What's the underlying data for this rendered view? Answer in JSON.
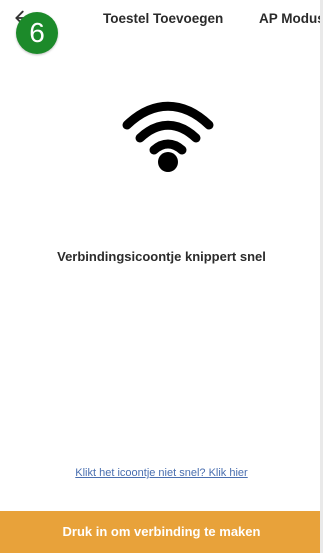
{
  "header": {
    "step_number": "6",
    "title": "Toestel Toevoegen",
    "mode_tab": "AP Modus"
  },
  "main": {
    "status_text": "Verbindingsicoontje knippert snel",
    "help_link": "Klikt het icoontje niet snel? Klik hier"
  },
  "footer": {
    "connect_button": "Druk in om verbinding te maken"
  },
  "icons": {
    "back": "arrow-left-icon",
    "wifi": "wifi-icon"
  },
  "colors": {
    "step_badge": "#1c8a2a",
    "button": "#e8a23a",
    "link": "#4a6fb0",
    "text": "#2b2b2b"
  }
}
